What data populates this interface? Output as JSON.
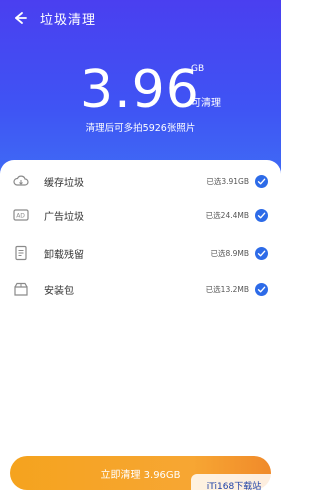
{
  "header": {
    "title": "垃圾清理"
  },
  "summary": {
    "value": "3.96",
    "unit": "GB",
    "suffix": "可清理",
    "hint": "清理后可多拍5926张照片"
  },
  "items": [
    {
      "label": "缓存垃圾",
      "status": "已选3.91GB",
      "checked": true,
      "icon": "cloud-icon"
    },
    {
      "label": "广告垃圾",
      "status": "已选24.4MB",
      "checked": true,
      "icon": "ad-icon"
    },
    {
      "label": "卸载残留",
      "status": "已选8.9MB",
      "checked": true,
      "icon": "document-icon"
    },
    {
      "label": "安装包",
      "status": "已选13.2MB",
      "checked": true,
      "icon": "package-icon"
    }
  ],
  "cta": {
    "label": "立即清理 3.96GB"
  },
  "watermark": {
    "text": "iTi168下载站"
  },
  "colors": {
    "header": "#4a3ff0",
    "check": "#2d6be8",
    "cta": "#f5a31e"
  }
}
